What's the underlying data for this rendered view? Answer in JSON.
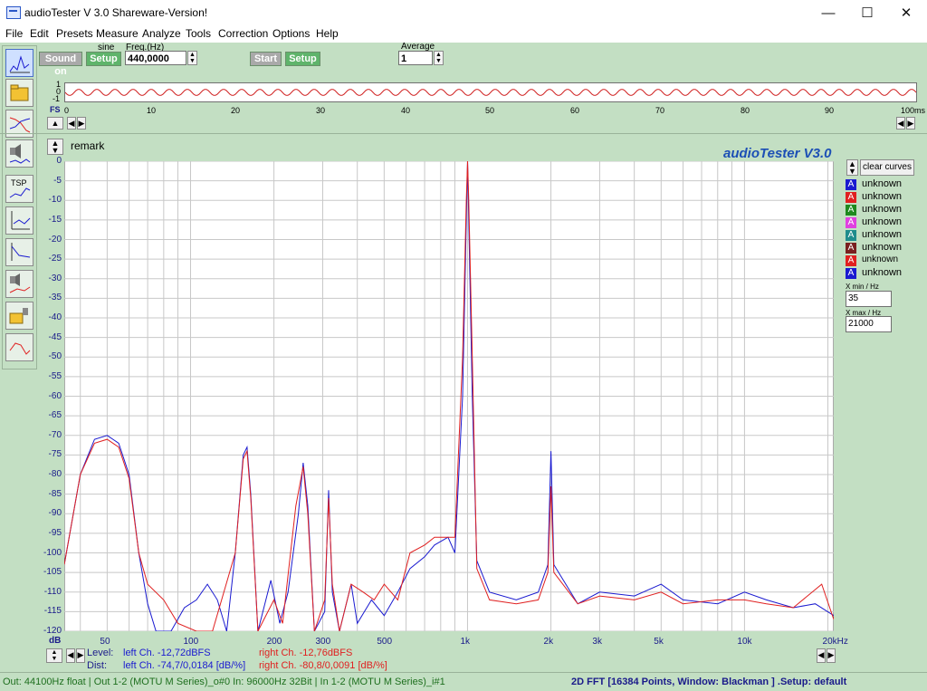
{
  "window": {
    "title": "audioTester  V 3.0 Shareware-Version!",
    "minimize": "—",
    "maximize": "☐",
    "close": "✕"
  },
  "menu": [
    "File",
    "Edit",
    "Presets",
    "Measure",
    "Analyze",
    "Tools",
    "Correction",
    "Options",
    "Help"
  ],
  "generator": {
    "sound_on_label": "Sound on",
    "signal_type": "sine",
    "setup_label": "Setup",
    "freq_label": "Freq.(Hz)",
    "freq_value": "440,0000"
  },
  "analyzer": {
    "start_label": "Start",
    "setup_label": "Setup",
    "average_label": "Average",
    "average_value": "1"
  },
  "scope": {
    "y_ticks": [
      "1",
      "0",
      "-1"
    ],
    "x_ticks": [
      "0",
      "10",
      "20",
      "30",
      "40",
      "50",
      "60",
      "70",
      "80",
      "90",
      "100ms"
    ],
    "fs_label": "FS",
    "nav_left": "◀",
    "nav_right": "▶",
    "spin_up": "▲",
    "spin_down": "▼"
  },
  "plot_header": {
    "remark": "remark",
    "brand": "audioTester  V3.0"
  },
  "legend": {
    "clear_label": "clear curves",
    "curves": [
      {
        "letter": "A",
        "label": "unknown",
        "color": "#1a1ad0"
      },
      {
        "letter": "A",
        "label": "unknown",
        "color": "#e02020"
      },
      {
        "letter": "A",
        "label": "unknown",
        "color": "#1e8a1e"
      },
      {
        "letter": "A",
        "label": "unknown",
        "color": "#e040e0"
      },
      {
        "letter": "A",
        "label": "unknown",
        "color": "#1f8c8c"
      },
      {
        "letter": "A",
        "label": "unknown",
        "color": "#7a1f1f"
      },
      {
        "letter": "A",
        "label": "unknown",
        "color": "#e02020"
      },
      {
        "letter": "A",
        "label": "unknown",
        "color": "#1a1ad0"
      }
    ],
    "xmin_label": "X min / Hz",
    "xmin_value": "35",
    "xmax_label": "X max / Hz",
    "xmax_value": "21000"
  },
  "readout": {
    "db_label": "dB",
    "level_label": "Level:",
    "dist_label": "Dist:",
    "left_level": "left Ch. -12,72dBFS",
    "left_dist": "left Ch.  -74,7/0,0184 [dB/%]",
    "right_level": "right Ch. -12,76dBFS",
    "right_dist": "right Ch. -80,8/0,0091 [dB/%]"
  },
  "status": {
    "left": "Out: 44100Hz float  | Out 1-2 (MOTU M Series)_o#0  In: 96000Hz 32Bit  | In 1-2 (MOTU M Series)_i#1",
    "right": "2D FFT [16384 Points, Window: Blackman ]  .Setup:  default"
  },
  "chart_data": {
    "type": "line",
    "xscale": "log",
    "xlim": [
      35,
      21000
    ],
    "ylim": [
      -120,
      0
    ],
    "grid": true,
    "x_ticks": [
      {
        "v": 50,
        "l": "50"
      },
      {
        "v": 100,
        "l": "100"
      },
      {
        "v": 200,
        "l": "200"
      },
      {
        "v": 300,
        "l": "300"
      },
      {
        "v": 500,
        "l": "500"
      },
      {
        "v": 1000,
        "l": "1k"
      },
      {
        "v": 2000,
        "l": "2k"
      },
      {
        "v": 3000,
        "l": "3k"
      },
      {
        "v": 5000,
        "l": "5k"
      },
      {
        "v": 10000,
        "l": "10k"
      },
      {
        "v": 20000,
        "l": "20kHz"
      }
    ],
    "y_ticks": [
      0,
      -5,
      -10,
      -15,
      -20,
      -25,
      -30,
      -35,
      -40,
      -45,
      -50,
      -55,
      -60,
      -65,
      -70,
      -75,
      -80,
      -85,
      -90,
      -95,
      -100,
      -105,
      -110,
      -115,
      -120
    ],
    "series": [
      {
        "color": "#1a1ad0",
        "points": [
          [
            35,
            -103
          ],
          [
            40,
            -80
          ],
          [
            45,
            -71
          ],
          [
            50,
            -70
          ],
          [
            55,
            -72
          ],
          [
            60,
            -80
          ],
          [
            65,
            -100
          ],
          [
            70,
            -113
          ],
          [
            75,
            -120
          ],
          [
            85,
            -120
          ],
          [
            95,
            -114
          ],
          [
            105,
            -112
          ],
          [
            115,
            -108
          ],
          [
            125,
            -112
          ],
          [
            135,
            -120
          ],
          [
            145,
            -100
          ],
          [
            155,
            -75
          ],
          [
            160,
            -73
          ],
          [
            165,
            -85
          ],
          [
            175,
            -120
          ],
          [
            195,
            -107
          ],
          [
            210,
            -118
          ],
          [
            225,
            -110
          ],
          [
            245,
            -90
          ],
          [
            255,
            -77
          ],
          [
            265,
            -88
          ],
          [
            280,
            -120
          ],
          [
            305,
            -115
          ],
          [
            315,
            -84
          ],
          [
            325,
            -110
          ],
          [
            345,
            -120
          ],
          [
            380,
            -108
          ],
          [
            400,
            -118
          ],
          [
            450,
            -112
          ],
          [
            500,
            -116
          ],
          [
            560,
            -110
          ],
          [
            620,
            -104
          ],
          [
            700,
            -101
          ],
          [
            760,
            -98
          ],
          [
            850,
            -96
          ],
          [
            900,
            -100
          ],
          [
            960,
            -60
          ],
          [
            990,
            -15
          ],
          [
            1000,
            0
          ],
          [
            1010,
            -15
          ],
          [
            1040,
            -60
          ],
          [
            1080,
            -102
          ],
          [
            1200,
            -110
          ],
          [
            1500,
            -112
          ],
          [
            1800,
            -110
          ],
          [
            1950,
            -103
          ],
          [
            2000,
            -74
          ],
          [
            2050,
            -103
          ],
          [
            2500,
            -113
          ],
          [
            3000,
            -110
          ],
          [
            4000,
            -111
          ],
          [
            5000,
            -108
          ],
          [
            6000,
            -112
          ],
          [
            8000,
            -113
          ],
          [
            10000,
            -110
          ],
          [
            12000,
            -112
          ],
          [
            15000,
            -114
          ],
          [
            18000,
            -113
          ],
          [
            21000,
            -116
          ]
        ]
      },
      {
        "color": "#e02020",
        "points": [
          [
            35,
            -103
          ],
          [
            40,
            -80
          ],
          [
            45,
            -72
          ],
          [
            50,
            -71
          ],
          [
            55,
            -73
          ],
          [
            60,
            -81
          ],
          [
            65,
            -100
          ],
          [
            70,
            -108
          ],
          [
            80,
            -112
          ],
          [
            90,
            -118
          ],
          [
            105,
            -120
          ],
          [
            120,
            -120
          ],
          [
            145,
            -100
          ],
          [
            155,
            -76
          ],
          [
            160,
            -74
          ],
          [
            165,
            -86
          ],
          [
            175,
            -120
          ],
          [
            200,
            -112
          ],
          [
            215,
            -118
          ],
          [
            240,
            -88
          ],
          [
            255,
            -78
          ],
          [
            265,
            -90
          ],
          [
            280,
            -120
          ],
          [
            305,
            -112
          ],
          [
            315,
            -86
          ],
          [
            325,
            -108
          ],
          [
            345,
            -120
          ],
          [
            380,
            -108
          ],
          [
            420,
            -110
          ],
          [
            460,
            -112
          ],
          [
            500,
            -108
          ],
          [
            560,
            -112
          ],
          [
            620,
            -100
          ],
          [
            700,
            -98
          ],
          [
            760,
            -96
          ],
          [
            850,
            -96
          ],
          [
            900,
            -96
          ],
          [
            960,
            -50
          ],
          [
            990,
            -10
          ],
          [
            1000,
            0
          ],
          [
            1010,
            -10
          ],
          [
            1040,
            -50
          ],
          [
            1080,
            -104
          ],
          [
            1200,
            -112
          ],
          [
            1500,
            -113
          ],
          [
            1800,
            -112
          ],
          [
            1950,
            -105
          ],
          [
            2000,
            -83
          ],
          [
            2050,
            -105
          ],
          [
            2500,
            -113
          ],
          [
            3000,
            -111
          ],
          [
            4000,
            -112
          ],
          [
            5000,
            -110
          ],
          [
            6000,
            -113
          ],
          [
            8000,
            -112
          ],
          [
            10000,
            -112
          ],
          [
            12000,
            -113
          ],
          [
            15000,
            -114
          ],
          [
            19000,
            -108
          ],
          [
            21000,
            -117
          ]
        ]
      }
    ]
  }
}
